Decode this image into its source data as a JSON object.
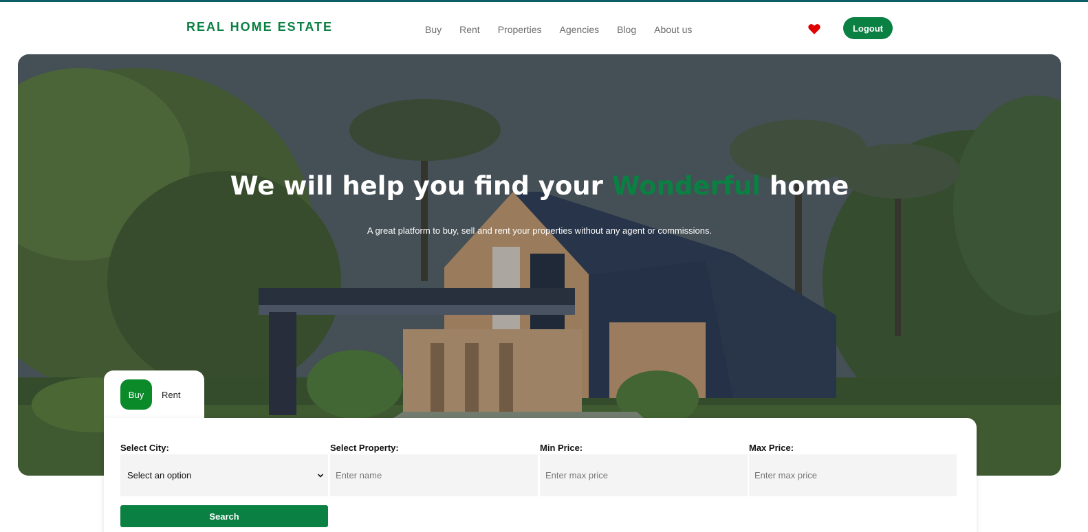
{
  "brand": {
    "logo": "REAL HOME ESTATE"
  },
  "nav": {
    "items": [
      {
        "label": "Buy"
      },
      {
        "label": "Rent"
      },
      {
        "label": "Properties"
      },
      {
        "label": "Agencies"
      },
      {
        "label": "Blog"
      },
      {
        "label": "About us"
      }
    ],
    "favorites_icon": "heart-icon",
    "logout_label": "Logout"
  },
  "hero": {
    "title_before": "We will help you find your ",
    "title_accent": "Wonderful",
    "title_after": " home",
    "subtitle": "A great platform to buy, sell and rent your properties without any agent or commissions."
  },
  "search": {
    "tabs": [
      {
        "label": "Buy",
        "active": true
      },
      {
        "label": "Rent",
        "active": false
      }
    ],
    "fields": {
      "city": {
        "label": "Select City:",
        "value": "Select an option"
      },
      "property": {
        "label": "Select Property:",
        "placeholder": "Enter name"
      },
      "min_price": {
        "label": "Min Price:",
        "placeholder": "Enter max price"
      },
      "max_price": {
        "label": "Max Price:",
        "placeholder": "Enter max price"
      }
    },
    "button_label": "Search"
  },
  "colors": {
    "brand_green": "#0b8043",
    "tab_green": "#0b8a2a",
    "heart_red": "#e00000",
    "top_line": "#0b5d66"
  }
}
